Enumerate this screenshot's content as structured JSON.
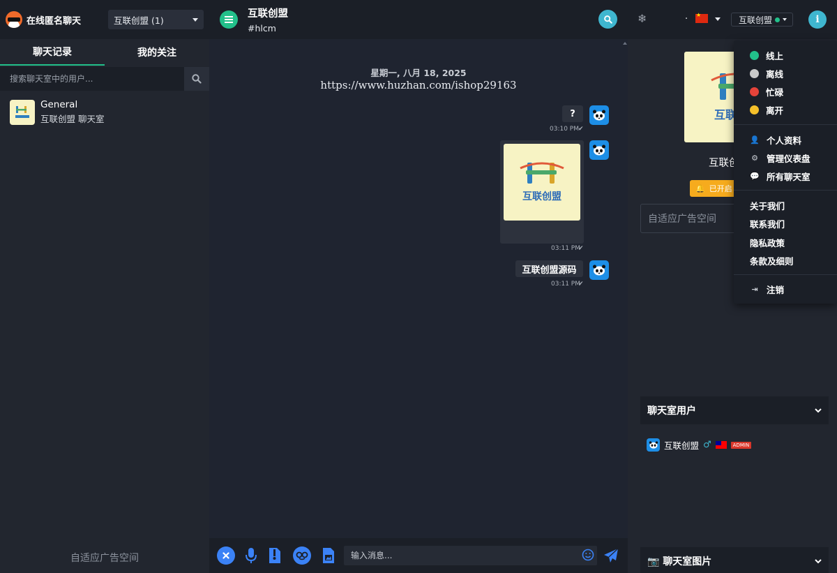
{
  "left": {
    "brand": "在线匿名聊天",
    "room_select": "互联创盟 (1)",
    "tabs": [
      "聊天记录",
      "我的关注"
    ],
    "search_placeholder": "搜索聊天室中的用户...",
    "rooms": [
      {
        "name": "General",
        "desc": "互联创盟 聊天室"
      }
    ],
    "ad_text": "自适应广告空间"
  },
  "header": {
    "title": "互联创盟",
    "subtitle": "#hlcm"
  },
  "chat": {
    "date": "星期一, 八月 18, 2025",
    "watermark": "https://www.huzhan.com/ishop29163",
    "messages": [
      {
        "text": "?",
        "time": "03:10 PM"
      },
      {
        "text": "互联创盟",
        "time": "03:11 PM",
        "image_caption": "互联创盟"
      },
      {
        "text": "互联创盟源码",
        "time": "03:11 PM"
      }
    ],
    "input_placeholder": "输入消息..."
  },
  "right": {
    "lang_dot": ".",
    "user_button": "互联创盟",
    "room_name": "互联创盟",
    "notify_label": "已开启",
    "ad_text": "自适应广告空间",
    "users_panel": "聊天室用户",
    "user_name": "互联创盟",
    "gender": "♂",
    "badge": "ADMIN",
    "images_panel": "聊天室图片"
  },
  "menu": {
    "statuses": [
      {
        "label": "线上",
        "color": "#22c08a"
      },
      {
        "label": "离线",
        "color": "#c9c9c9"
      },
      {
        "label": "忙碌",
        "color": "#e5433a"
      },
      {
        "label": "离开",
        "color": "#f5c02a"
      }
    ],
    "profile": "个人资料",
    "dashboard": "管理仪表盘",
    "all_rooms": "所有聊天室",
    "about": "关于我们",
    "contact": "联系我们",
    "privacy": "隐私政策",
    "terms": "条款及细则",
    "logout": "注销"
  },
  "colors": {
    "accent_green": "#22c08a",
    "accent_cyan": "#3fb6cf",
    "avatar_blue": "#1d8ee6",
    "notify_orange": "#f6ab1d"
  }
}
